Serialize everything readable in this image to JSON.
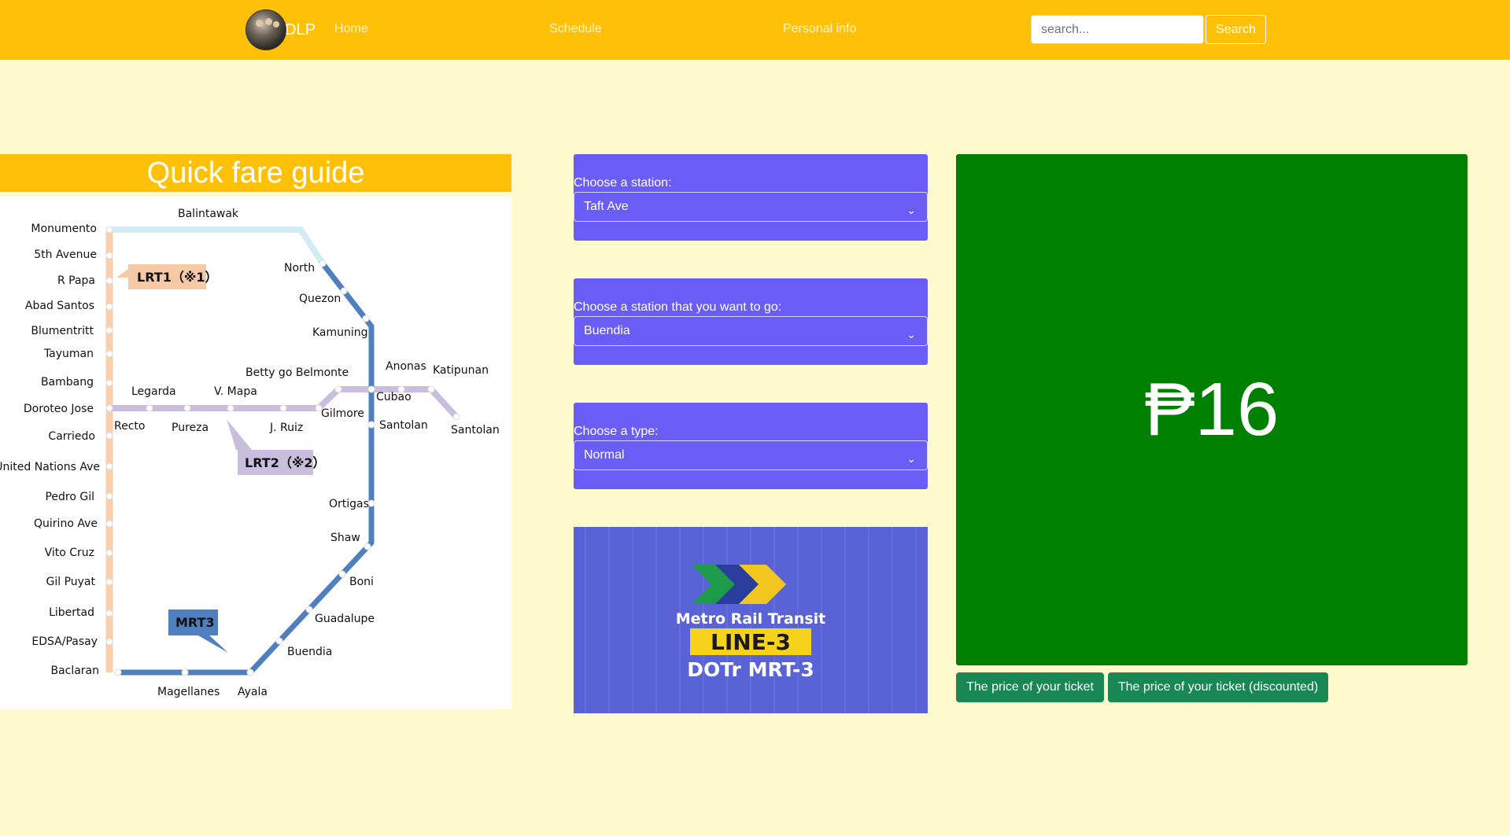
{
  "nav": {
    "brand": "DLP",
    "links": [
      "Home",
      "Schedule",
      "Personal info"
    ],
    "search_placeholder": "search...",
    "search_button": "Search"
  },
  "fare_guide": {
    "title": "Quick fare guide",
    "map": {
      "lrt1_stations": [
        "Monumento",
        "5th Avenue",
        "R Papa",
        "Abad Santos",
        "Blumentritt",
        "Tayuman",
        "Bambang",
        "Doroteo Jose",
        "Carriedo",
        "United Nations Ave",
        "Pedro Gil",
        "Quirino Ave",
        "Vito Cruz",
        "Gil Puyat",
        "Libertad",
        "EDSA/Pasay",
        "Baclaran"
      ],
      "north_stations": [
        "Balintawak",
        "North",
        "Quezon",
        "Kamuning"
      ],
      "lrt2_stations": [
        "Recto",
        "Legarda",
        "Pureza",
        "V. Mapa",
        "J. Ruiz",
        "Gilmore",
        "Betty go Belmonte",
        "Cubao",
        "Anonas",
        "Katipunan",
        "Santolan"
      ],
      "mrt3_stations": [
        "Santolan",
        "Ortigas",
        "Shaw",
        "Boni",
        "Guadalupe",
        "Buendia",
        "Ayala",
        "Magellanes"
      ],
      "tags": {
        "lrt1": "LRT1（※1）",
        "lrt2": "LRT2（※2）",
        "mrt3": "MRT3"
      },
      "colors": {
        "lrt1": "#f9cfae",
        "lrt2": "#c9bedd",
        "mrt3": "#4f7fbf",
        "tag_lrt1": "#f6c9a6",
        "tag_lrt2": "#c9bedd",
        "tag_mrt3": "#4f7fbf"
      }
    }
  },
  "form": {
    "from_label": "Choose a station:",
    "from_value": "Taft Ave",
    "to_label": "Choose a station that you want to go:",
    "to_value": "Buendia",
    "type_label": "Choose a type:",
    "type_value": "Normal"
  },
  "banner": {
    "line1": "Metro Rail Transit",
    "line2": "LINE-3",
    "line3": "DOTr MRT-3"
  },
  "result": {
    "price": "₱16",
    "btn_normal": "The price of your ticket",
    "btn_discounted": "The price of your ticket (discounted)"
  },
  "colors": {
    "navbar": "#ffc107",
    "page_bg": "#fffacd",
    "panel": "#6a5df5",
    "price_bg": "#008000",
    "button": "#198754"
  }
}
